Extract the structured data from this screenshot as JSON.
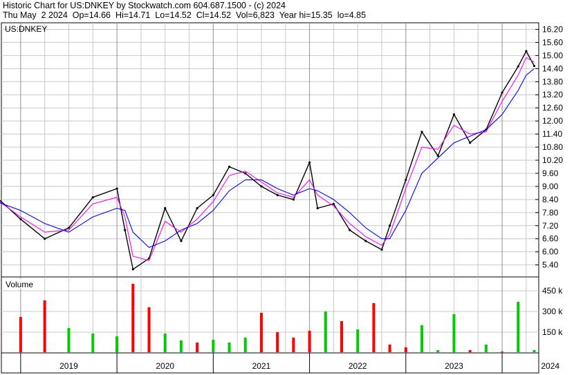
{
  "header": {
    "line1": "Historic Chart for US:DNKEY by Stockwatch.com 604.687.1500 - (c) 2024",
    "line2": "Thu May  2 2024  Op=14.66  Hi=14.71  Lo=14.52  Cl=14.52  Vol=6,823  Year hi=15.35  lo=4.85"
  },
  "chart_data": [
    {
      "type": "line",
      "panel": "price",
      "title": "US:DNKEY",
      "ylim": [
        4.85,
        16.5
      ],
      "y_ticks": [
        "16.20",
        "15.60",
        "15.00",
        "14.40",
        "13.80",
        "13.20",
        "12.60",
        "12.00",
        "11.40",
        "10.80",
        "10.20",
        "9.60",
        "9.00",
        "8.40",
        "7.80",
        "7.20",
        "6.60",
        "6.00",
        "5.40"
      ],
      "x_ticks": [
        "2019",
        "2020",
        "2021",
        "2022",
        "2023",
        "2024"
      ],
      "x": [
        "2018-10",
        "2019-01",
        "2019-04",
        "2019-07",
        "2019-10",
        "2020-01",
        "2020-02",
        "2020-03",
        "2020-05",
        "2020-07",
        "2020-09",
        "2020-11",
        "2021-01",
        "2021-03",
        "2021-05",
        "2021-07",
        "2021-09",
        "2021-11",
        "2022-01",
        "2022-02",
        "2022-04",
        "2022-06",
        "2022-08",
        "2022-10",
        "2022-11",
        "2023-01",
        "2023-03",
        "2023-05",
        "2023-07",
        "2023-09",
        "2023-11",
        "2024-01",
        "2024-03",
        "2024-04",
        "2024-05"
      ],
      "series": [
        {
          "color": "#000000",
          "values": [
            8.5,
            7.5,
            6.6,
            7.1,
            8.5,
            8.9,
            7.0,
            5.2,
            5.7,
            8.0,
            6.5,
            8.0,
            8.6,
            9.9,
            9.6,
            9.0,
            8.6,
            8.4,
            10.1,
            8.0,
            8.2,
            7.0,
            6.5,
            6.1,
            7.2,
            9.3,
            11.5,
            10.4,
            12.3,
            11.0,
            11.6,
            13.3,
            14.5,
            15.2,
            14.52
          ]
        },
        {
          "color": "#ff00ff",
          "values": [
            8.4,
            7.6,
            6.9,
            7.0,
            8.2,
            8.5,
            7.6,
            5.8,
            5.6,
            7.4,
            6.9,
            7.5,
            8.3,
            9.5,
            9.7,
            9.2,
            8.7,
            8.5,
            9.3,
            8.6,
            8.1,
            7.3,
            6.7,
            6.3,
            6.8,
            8.9,
            10.8,
            10.7,
            11.8,
            11.4,
            11.5,
            12.9,
            14.1,
            14.9,
            14.7
          ]
        },
        {
          "color": "#0000ff",
          "values": [
            8.3,
            7.9,
            7.3,
            6.9,
            7.6,
            8.0,
            7.9,
            6.9,
            6.2,
            6.5,
            7.0,
            7.3,
            7.9,
            8.8,
            9.3,
            9.3,
            8.9,
            8.6,
            8.9,
            8.8,
            8.4,
            7.8,
            7.1,
            6.6,
            6.6,
            7.9,
            9.6,
            10.3,
            11.0,
            11.3,
            11.6,
            12.3,
            13.4,
            14.1,
            14.4
          ]
        }
      ]
    },
    {
      "type": "bar",
      "panel": "volume",
      "title": "Volume",
      "ylim": [
        0,
        550
      ],
      "y_ticks": [
        "450 k",
        "300 k",
        "150 k"
      ],
      "unit": "k",
      "x": [
        "2018-10",
        "2019-01",
        "2019-04",
        "2019-07",
        "2019-10",
        "2020-01",
        "2020-03",
        "2020-05",
        "2020-07",
        "2020-09",
        "2020-11",
        "2021-01",
        "2021-03",
        "2021-05",
        "2021-07",
        "2021-09",
        "2021-11",
        "2022-01",
        "2022-03",
        "2022-05",
        "2022-07",
        "2022-09",
        "2022-11",
        "2023-01",
        "2023-03",
        "2023-05",
        "2023-07",
        "2023-09",
        "2023-11",
        "2024-01",
        "2024-03",
        "2024-05"
      ],
      "values": [
        150,
        260,
        380,
        180,
        140,
        120,
        500,
        330,
        140,
        90,
        75,
        95,
        75,
        110,
        290,
        150,
        110,
        160,
        300,
        230,
        170,
        360,
        60,
        40,
        200,
        20,
        280,
        20,
        60,
        10,
        370,
        20
      ],
      "colors": {
        "up": "#00cc00",
        "down": "#ff0000"
      }
    }
  ]
}
